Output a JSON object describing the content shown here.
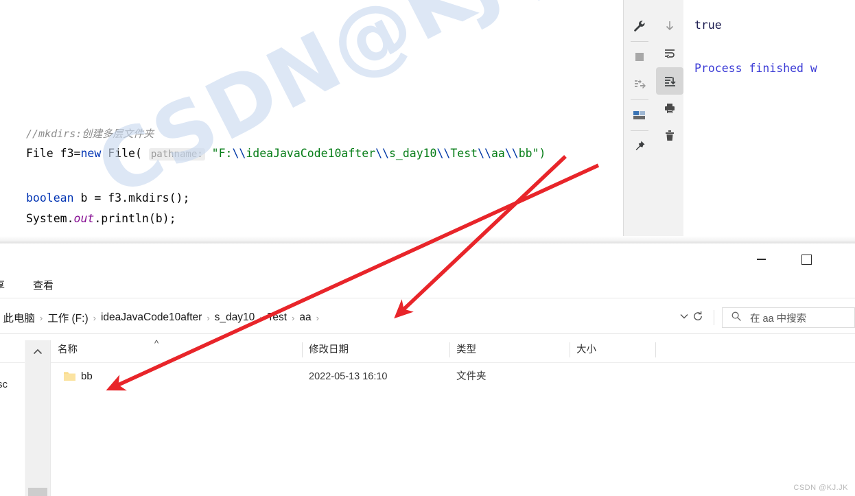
{
  "ide": {
    "code": {
      "comment": "//mkdirs:创建多层文件夹",
      "line_file": {
        "prefix": "File f3=",
        "keyword_new": "new",
        "ctor": " File( ",
        "param_hint": "pathname:",
        "string_open": "\"F:",
        "esc1": "\\\\",
        "seg1": "ideaJavaCode10after",
        "esc2": "\\\\",
        "seg2": "s_day10",
        "esc3": "\\\\",
        "seg3": "Test",
        "esc4": "\\\\",
        "seg4": "aa",
        "esc5": "\\\\",
        "seg5": "bb",
        "string_close": "\")"
      },
      "line_bool": {
        "keyword": "boolean",
        "rest": " b = f3.mkdirs();"
      },
      "line_print": {
        "prefix": "System.",
        "field": "out",
        "rest": ".println(b);"
      }
    },
    "toolbar_left": [
      {
        "name": "settings-wrench-icon",
        "label": "Settings"
      },
      {
        "name": "stop-square-icon",
        "label": "Stop"
      },
      {
        "name": "rerun-failed-tests-icon",
        "label": "Rerun failed tests"
      },
      {
        "name": "layout-windows-icon",
        "label": "Layout"
      },
      {
        "name": "pin-tab-icon",
        "label": "Pin Tab"
      }
    ],
    "toolbar_right": [
      {
        "name": "scroll-down-arrow-icon",
        "label": "Scroll to end"
      },
      {
        "name": "soft-wrap-icon",
        "label": "Soft-Wrap"
      },
      {
        "name": "scroll-to-end-icon",
        "label": "Scroll to the end",
        "active": true
      },
      {
        "name": "print-icon",
        "label": "Print"
      },
      {
        "name": "clear-all-trash-icon",
        "label": "Clear All"
      }
    ],
    "console": {
      "output_value": "true",
      "process_message": "Process finished w"
    }
  },
  "explorer": {
    "window_buttons": {
      "minimize": "—",
      "maximize": "□"
    },
    "ribbon_tabs": [
      {
        "label": "享"
      },
      {
        "label": "查看"
      }
    ],
    "breadcrumb": {
      "separator": "›",
      "items": [
        "此电脑",
        "工作 (F:)",
        "ideaJavaCode10after",
        "s_day10",
        "Test",
        "aa"
      ]
    },
    "address_controls": {
      "dropdown": "chevron-down-icon",
      "refresh": "refresh-icon"
    },
    "search": {
      "placeholder": "在 aa 中搜索",
      "icon": "search-icon"
    },
    "columns": [
      {
        "label": "名称"
      },
      {
        "label": "修改日期"
      },
      {
        "label": "类型"
      },
      {
        "label": "大小"
      }
    ],
    "sort_indicator": "^",
    "rows": [
      {
        "icon": "folder-icon",
        "name": "bb",
        "date": "2022-05-13 16:10",
        "type": "文件夹",
        "size": ""
      }
    ],
    "nav_remnant": "sc"
  },
  "watermarks": {
    "diagonal": "CSDN@KJ.JK",
    "corner": "CSDN @KJ.JK"
  },
  "annotations": {
    "arrow_color": "#e8252a",
    "arrows": [
      {
        "name": "arrow-code-path-to-folder-row",
        "from": "code path aa\\\\bb",
        "to": "bb folder row"
      },
      {
        "name": "arrow-code-path-to-breadcrumb-aa",
        "from": "code path aa",
        "to": "breadcrumb aa"
      }
    ]
  },
  "colors": {
    "keyword": "#0033b3",
    "string": "#067d17",
    "string_escape": "#0037a6",
    "static_field": "#871094",
    "comment": "#8c8c8c",
    "console_text": "#1a1a4e",
    "console_process": "#3b3bd6",
    "folder": "#f7d684",
    "watermark": "#c9d9ef",
    "annotation_red": "#e8252a"
  }
}
